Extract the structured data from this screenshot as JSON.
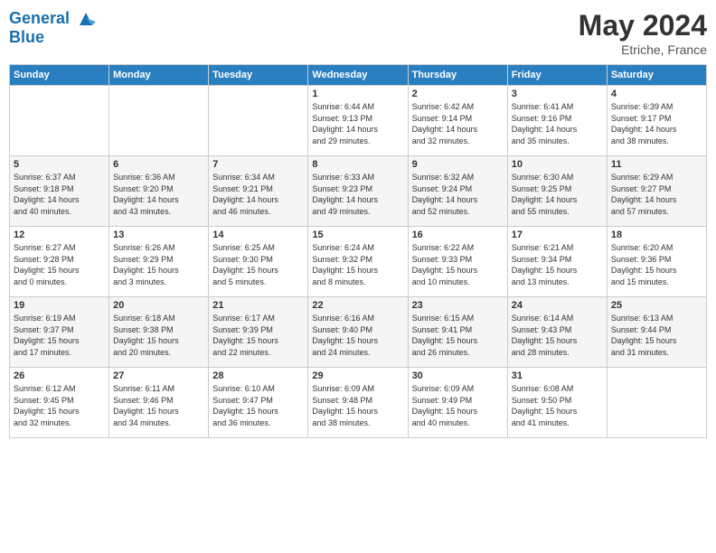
{
  "header": {
    "logo_line1": "General",
    "logo_line2": "Blue",
    "month_year": "May 2024",
    "location": "Etriche, France"
  },
  "weekdays": [
    "Sunday",
    "Monday",
    "Tuesday",
    "Wednesday",
    "Thursday",
    "Friday",
    "Saturday"
  ],
  "weeks": [
    [
      {
        "day": "",
        "info": ""
      },
      {
        "day": "",
        "info": ""
      },
      {
        "day": "",
        "info": ""
      },
      {
        "day": "1",
        "info": "Sunrise: 6:44 AM\nSunset: 9:13 PM\nDaylight: 14 hours\nand 29 minutes."
      },
      {
        "day": "2",
        "info": "Sunrise: 6:42 AM\nSunset: 9:14 PM\nDaylight: 14 hours\nand 32 minutes."
      },
      {
        "day": "3",
        "info": "Sunrise: 6:41 AM\nSunset: 9:16 PM\nDaylight: 14 hours\nand 35 minutes."
      },
      {
        "day": "4",
        "info": "Sunrise: 6:39 AM\nSunset: 9:17 PM\nDaylight: 14 hours\nand 38 minutes."
      }
    ],
    [
      {
        "day": "5",
        "info": "Sunrise: 6:37 AM\nSunset: 9:18 PM\nDaylight: 14 hours\nand 40 minutes."
      },
      {
        "day": "6",
        "info": "Sunrise: 6:36 AM\nSunset: 9:20 PM\nDaylight: 14 hours\nand 43 minutes."
      },
      {
        "day": "7",
        "info": "Sunrise: 6:34 AM\nSunset: 9:21 PM\nDaylight: 14 hours\nand 46 minutes."
      },
      {
        "day": "8",
        "info": "Sunrise: 6:33 AM\nSunset: 9:23 PM\nDaylight: 14 hours\nand 49 minutes."
      },
      {
        "day": "9",
        "info": "Sunrise: 6:32 AM\nSunset: 9:24 PM\nDaylight: 14 hours\nand 52 minutes."
      },
      {
        "day": "10",
        "info": "Sunrise: 6:30 AM\nSunset: 9:25 PM\nDaylight: 14 hours\nand 55 minutes."
      },
      {
        "day": "11",
        "info": "Sunrise: 6:29 AM\nSunset: 9:27 PM\nDaylight: 14 hours\nand 57 minutes."
      }
    ],
    [
      {
        "day": "12",
        "info": "Sunrise: 6:27 AM\nSunset: 9:28 PM\nDaylight: 15 hours\nand 0 minutes."
      },
      {
        "day": "13",
        "info": "Sunrise: 6:26 AM\nSunset: 9:29 PM\nDaylight: 15 hours\nand 3 minutes."
      },
      {
        "day": "14",
        "info": "Sunrise: 6:25 AM\nSunset: 9:30 PM\nDaylight: 15 hours\nand 5 minutes."
      },
      {
        "day": "15",
        "info": "Sunrise: 6:24 AM\nSunset: 9:32 PM\nDaylight: 15 hours\nand 8 minutes."
      },
      {
        "day": "16",
        "info": "Sunrise: 6:22 AM\nSunset: 9:33 PM\nDaylight: 15 hours\nand 10 minutes."
      },
      {
        "day": "17",
        "info": "Sunrise: 6:21 AM\nSunset: 9:34 PM\nDaylight: 15 hours\nand 13 minutes."
      },
      {
        "day": "18",
        "info": "Sunrise: 6:20 AM\nSunset: 9:36 PM\nDaylight: 15 hours\nand 15 minutes."
      }
    ],
    [
      {
        "day": "19",
        "info": "Sunrise: 6:19 AM\nSunset: 9:37 PM\nDaylight: 15 hours\nand 17 minutes."
      },
      {
        "day": "20",
        "info": "Sunrise: 6:18 AM\nSunset: 9:38 PM\nDaylight: 15 hours\nand 20 minutes."
      },
      {
        "day": "21",
        "info": "Sunrise: 6:17 AM\nSunset: 9:39 PM\nDaylight: 15 hours\nand 22 minutes."
      },
      {
        "day": "22",
        "info": "Sunrise: 6:16 AM\nSunset: 9:40 PM\nDaylight: 15 hours\nand 24 minutes."
      },
      {
        "day": "23",
        "info": "Sunrise: 6:15 AM\nSunset: 9:41 PM\nDaylight: 15 hours\nand 26 minutes."
      },
      {
        "day": "24",
        "info": "Sunrise: 6:14 AM\nSunset: 9:43 PM\nDaylight: 15 hours\nand 28 minutes."
      },
      {
        "day": "25",
        "info": "Sunrise: 6:13 AM\nSunset: 9:44 PM\nDaylight: 15 hours\nand 31 minutes."
      }
    ],
    [
      {
        "day": "26",
        "info": "Sunrise: 6:12 AM\nSunset: 9:45 PM\nDaylight: 15 hours\nand 32 minutes."
      },
      {
        "day": "27",
        "info": "Sunrise: 6:11 AM\nSunset: 9:46 PM\nDaylight: 15 hours\nand 34 minutes."
      },
      {
        "day": "28",
        "info": "Sunrise: 6:10 AM\nSunset: 9:47 PM\nDaylight: 15 hours\nand 36 minutes."
      },
      {
        "day": "29",
        "info": "Sunrise: 6:09 AM\nSunset: 9:48 PM\nDaylight: 15 hours\nand 38 minutes."
      },
      {
        "day": "30",
        "info": "Sunrise: 6:09 AM\nSunset: 9:49 PM\nDaylight: 15 hours\nand 40 minutes."
      },
      {
        "day": "31",
        "info": "Sunrise: 6:08 AM\nSunset: 9:50 PM\nDaylight: 15 hours\nand 41 minutes."
      },
      {
        "day": "",
        "info": ""
      }
    ]
  ]
}
